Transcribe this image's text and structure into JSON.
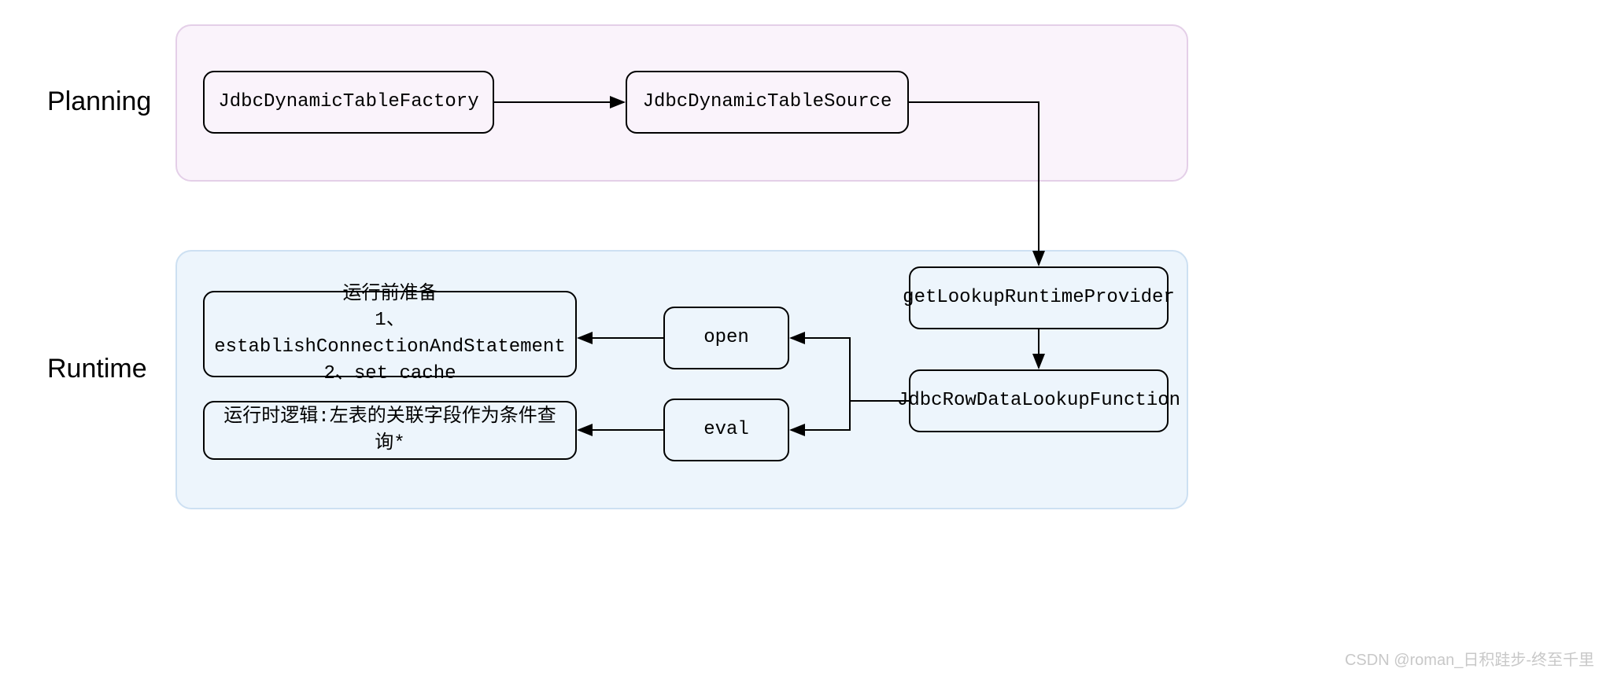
{
  "labels": {
    "planning": "Planning",
    "runtime": "Runtime"
  },
  "nodes": {
    "factory": "JdbcDynamicTableFactory",
    "source": "JdbcDynamicTableSource",
    "provider": "getLookupRuntimeProvider",
    "lookupFn": "JdbcRowDataLookupFunction",
    "open": "open",
    "eval": "eval",
    "openDesc_line1": "运行前准备",
    "openDesc_line2": "1、establishConnectionAndStatement",
    "openDesc_line3": "2、set cache",
    "evalDesc": "运行时逻辑:左表的关联字段作为条件查询*"
  },
  "colors": {
    "planningBg": "#faf3fb",
    "planningBorder": "#e4cfe8",
    "runtimeBg": "#edf5fc",
    "runtimeBorder": "#cde0f2"
  },
  "watermark": "CSDN @roman_日积跬步-终至千里"
}
